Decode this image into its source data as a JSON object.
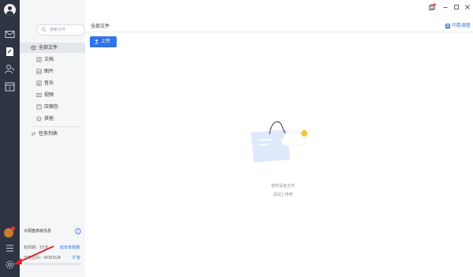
{
  "rail": {
    "icons": [
      "avatar-icon",
      "mail-icon",
      "files-icon",
      "contacts-icon",
      "calendar-icon",
      "user-badge-icon",
      "menu-icon",
      "settings-icon"
    ]
  },
  "sidebar": {
    "search_placeholder": "搜索文件",
    "items": [
      {
        "label": "全部文件",
        "icon": "cube-icon"
      },
      {
        "label": "文档",
        "icon": "document-icon"
      },
      {
        "label": "图片",
        "icon": "image-icon"
      },
      {
        "label": "音乐",
        "icon": "music-icon"
      },
      {
        "label": "视频",
        "icon": "video-icon"
      },
      {
        "label": "压缩包",
        "icon": "archive-icon"
      },
      {
        "label": "其他",
        "icon": "more-icon"
      },
      {
        "label": "任务列表",
        "icon": "transfer-icon"
      }
    ],
    "storage": {
      "title": "大网盘高级信息",
      "validity": "有效期：15天",
      "extend_link": "延长有效期",
      "usage": "已用空间：0KB/5GB",
      "expand_link": "扩容",
      "used_fraction": 0
    }
  },
  "main": {
    "title": "全部文件",
    "help_link": "问卷调查",
    "upload_button": "上传",
    "empty_line1": "暂时没有文件",
    "empty_line2": "试试上传吧"
  },
  "colors": {
    "rail_bg": "#2f3443",
    "accent": "#2f74e8",
    "link": "#2a72e5",
    "annotation_arrow": "#e02020"
  }
}
